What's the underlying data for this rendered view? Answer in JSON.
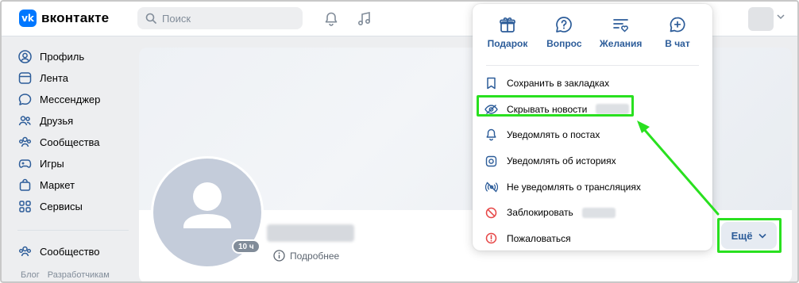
{
  "header": {
    "logo_text": "вконтакте",
    "logo_mark": "vk",
    "search_placeholder": "Поиск",
    "icons": [
      "bell-icon",
      "music-icon",
      "chevron-down-icon"
    ]
  },
  "sidebar": {
    "items": [
      {
        "label": "Профиль",
        "icon": "user-circle-icon"
      },
      {
        "label": "Лента",
        "icon": "feed-icon"
      },
      {
        "label": "Мессенджер",
        "icon": "chat-icon"
      },
      {
        "label": "Друзья",
        "icon": "friends-icon"
      },
      {
        "label": "Сообщества",
        "icon": "communities-icon"
      },
      {
        "label": "Игры",
        "icon": "gamepad-icon"
      },
      {
        "label": "Маркет",
        "icon": "bag-icon"
      },
      {
        "label": "Сервисы",
        "icon": "grid-icon"
      }
    ],
    "secondary": {
      "label": "Сообщество",
      "icon": "community-icon"
    },
    "footer": {
      "blog": "Блог",
      "developers": "Разработчикам"
    }
  },
  "profile": {
    "online_badge": "10 ч",
    "more_info_label": "Подробнее",
    "more_button_label": "Ещё"
  },
  "dropdown": {
    "quick_actions": [
      {
        "label": "Подарок",
        "icon": "gift-icon"
      },
      {
        "label": "Вопрос",
        "icon": "question-icon"
      },
      {
        "label": "Желания",
        "icon": "wishlist-icon"
      },
      {
        "label": "В чат",
        "icon": "chat-plus-icon"
      }
    ],
    "items": [
      {
        "label": "Сохранить в закладках",
        "icon": "bookmark-icon"
      },
      {
        "label": "Скрывать новости",
        "icon": "eye-slash-icon"
      },
      {
        "label": "Уведомлять о постах",
        "icon": "bell-icon"
      },
      {
        "label": "Уведомлять об историях",
        "icon": "story-icon"
      },
      {
        "label": "Не уведомлять о трансляциях",
        "icon": "broadcast-off-icon"
      },
      {
        "label": "Заблокировать",
        "icon": "block-icon"
      },
      {
        "label": "Пожаловаться",
        "icon": "report-icon"
      }
    ]
  },
  "colors": {
    "accent": "#0077ff",
    "link": "#2c5c99",
    "highlight": "#29e01f",
    "danger": "#e64646"
  }
}
